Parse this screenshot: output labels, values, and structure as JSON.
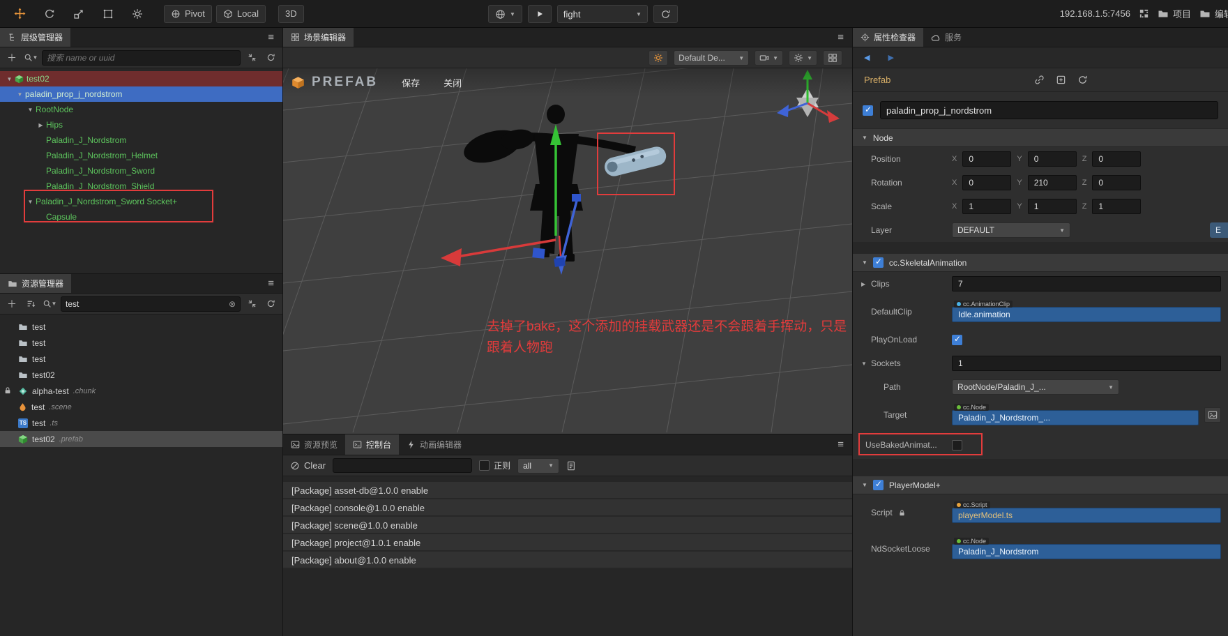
{
  "topbar": {
    "pivot": "Pivot",
    "local": "Local",
    "mode3d": "3D",
    "scene_name": "fight",
    "address": "192.168.1.5:7456",
    "project": "项目",
    "editor": "编辑器"
  },
  "hierarchy": {
    "title": "层级管理器",
    "search_placeholder": "搜索 name or uuid",
    "nodes": [
      {
        "label": "test02"
      },
      {
        "label": "paladin_prop_j_nordstrom"
      },
      {
        "label": "RootNode"
      },
      {
        "label": "Hips"
      },
      {
        "label": "Paladin_J_Nordstrom"
      },
      {
        "label": "Paladin_J_Nordstrom_Helmet"
      },
      {
        "label": "Paladin_J_Nordstrom_Sword"
      },
      {
        "label": "Paladin_J_Nordstrom_Shield"
      },
      {
        "label": "Paladin_J_Nordstrom_Sword Socket+"
      },
      {
        "label": "Capsule"
      }
    ]
  },
  "assets": {
    "title": "资源管理器",
    "search_value": "test",
    "items": [
      {
        "name": "test",
        "ext": ""
      },
      {
        "name": "test",
        "ext": ""
      },
      {
        "name": "test",
        "ext": ""
      },
      {
        "name": "test02",
        "ext": ""
      },
      {
        "name": "alpha-test",
        "ext": ".chunk"
      },
      {
        "name": "test",
        "ext": ".scene"
      },
      {
        "name": "test",
        "ext": ".ts"
      },
      {
        "name": "test02",
        "ext": ".prefab"
      }
    ]
  },
  "scene": {
    "title": "场景编辑器",
    "camera": "Default De...",
    "prefab": "PREFAB",
    "save": "保存",
    "close": "关闭",
    "note1": "去掉了bake，这个添加的挂载武器还是不会跟着手挥动，只是",
    "note2": "跟着人物跑"
  },
  "console": {
    "tab_preview": "资源预览",
    "tab_console": "控制台",
    "tab_anim": "动画编辑器",
    "clear": "Clear",
    "regex": "正则",
    "filter": "all",
    "lines": [
      "[Package] asset-db@1.0.0 enable",
      "[Package] console@1.0.0 enable",
      "[Package] scene@1.0.0 enable",
      "[Package] project@1.0.1 enable",
      "[Package] about@1.0.0 enable"
    ]
  },
  "inspector": {
    "tab_inspector": "属性检查器",
    "tab_service": "服务",
    "prefab": "Prefab",
    "node_name": "paladin_prop_j_nordstrom",
    "sec_node": "Node",
    "position": "Position",
    "rotation": "Rotation",
    "scale": "Scale",
    "layer": "Layer",
    "axis_x": "X",
    "axis_y": "Y",
    "axis_z": "Z",
    "pos": {
      "x": "0",
      "y": "0",
      "z": "0"
    },
    "rot": {
      "x": "0",
      "y": "210",
      "z": "0"
    },
    "scl": {
      "x": "1",
      "y": "1",
      "z": "1"
    },
    "layer_value": "DEFAULT",
    "layer_edit": "E",
    "sec_skeletal": "cc.SkeletalAnimation",
    "clips": "Clips",
    "clips_value": "7",
    "defaultclip": "DefaultClip",
    "defaultclip_type": "cc.AnimationClip",
    "defaultclip_value": "Idle.animation",
    "playonload": "PlayOnLoad",
    "sockets": "Sockets",
    "sockets_value": "1",
    "path": "Path",
    "path_value": "RootNode/Paladin_J_...",
    "target": "Target",
    "target_type": "cc.Node",
    "target_value": "Paladin_J_Nordstrom_...",
    "usebaked": "UseBakedAnimat...",
    "sec_player": "PlayerModel+",
    "script": "Script",
    "script_type": "cc.Script",
    "script_value": "playerModel.ts",
    "ndsocket": "NdSocketLoose",
    "ndsocket_type": "cc.Node",
    "ndsocket_value": "Paladin_J_Nordstrom"
  }
}
